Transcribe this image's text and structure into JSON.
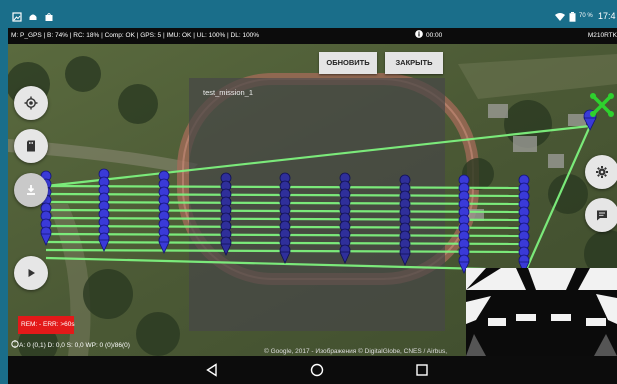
{
  "status_bar": {
    "battery_percent_label": "70 %",
    "clock": "17:4"
  },
  "telemetry": {
    "summary": "M: P_GPS | B: 74% | RC: 18% | Comp: OK | GPS: 5 | IMU: OK | UL: 100% | DL: 100%",
    "flight_time": "00:00",
    "drone_model": "M210RTK"
  },
  "mission": {
    "name": "test_mission_1",
    "refresh_label": "ОБНОВИТЬ",
    "close_label": "ЗАКРЫТЬ"
  },
  "overlay": {
    "rem_label": "REM: - ERR: >60s",
    "stats": "A: 0 (0,1) D: 0,0 S: 0,0   WP: 0 (0)/86(0)",
    "copyright": "© Google, 2017 - Изображения © DigitalGlobe, CNES / Airbus,"
  },
  "icons": {
    "locate": "crosshair-icon",
    "sd_card": "sd-card-icon",
    "download": "download-icon",
    "play": "play-icon",
    "settings": "gear-icon",
    "chat": "chat-icon",
    "drone": "drone-icon"
  },
  "colors": {
    "status_bar": "#1a6e8a",
    "route_line": "#7ef27e",
    "waypoint": "#3a3ad8",
    "rem_badge": "#e31919",
    "drone_marker": "#2ed12e"
  }
}
